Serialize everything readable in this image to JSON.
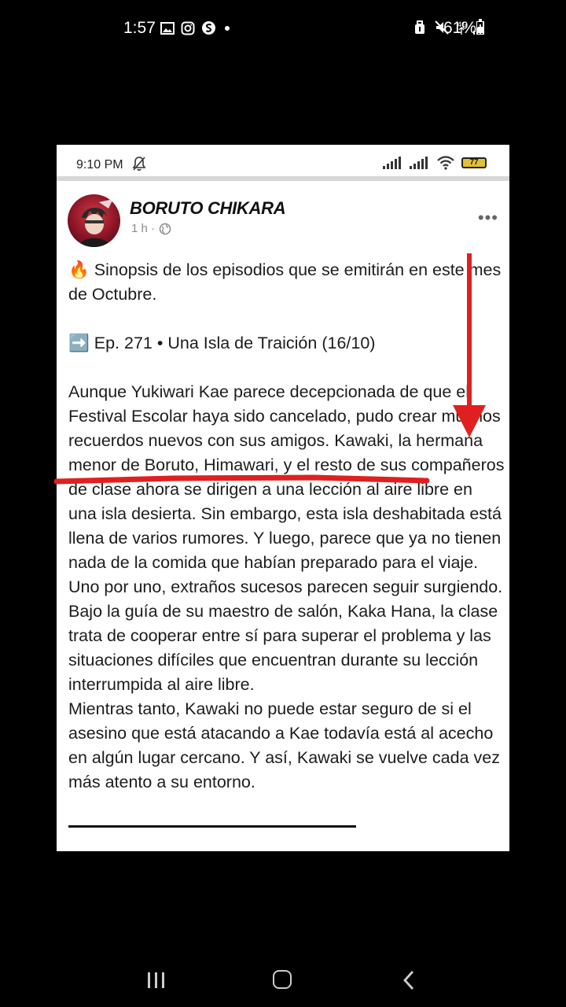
{
  "status_bar": {
    "time": "1:57",
    "battery": "61%",
    "icons_left": [
      "image-icon",
      "instagram-icon",
      "app-icon"
    ],
    "icons_right": [
      "alarm-icon",
      "mute-icon",
      "4g-signal-icon"
    ]
  },
  "screenshot": {
    "status_time": "9:10 PM",
    "battery_level": "77",
    "battery_color": "#e5c030"
  },
  "post": {
    "author": "BORUTO CHIKARA",
    "meta": "1 h ·",
    "intro": "🔥 Sinopsis de los episodios que se emitirán en este mes de Octubre.",
    "episode": "➡️ Ep. 271 • Una Isla de Traición (16/10)",
    "paragraph_1": "Aunque Yukiwari Kae parece decepcionada de que el Festival Escolar haya sido cancelado, pudo crear muchos recuerdos nuevos con sus amigos. Kawaki, la hermana menor de Boruto, Himawari, y el resto de sus compañeros de clase ahora se dirigen a una lección al aire libre en una isla desierta. Sin embargo, esta isla deshabitada está llena de varios rumores. Y luego, parece que ya no tienen nada de la comida que habían preparado para el viaje. Uno por uno, extraños sucesos parecen seguir surgiendo.",
    "paragraph_2": "Bajo la guía de su maestro de salón, Kaka Hana, la clase trata de cooperar entre sí para superar el problema y las situaciones difíciles que encuentran durante su lección interrumpida al aire libre.",
    "paragraph_3": "Mientras tanto, Kawaki no puede estar seguro de si el asesino que está atacando a Kae todavía está al acecho en algún lugar cercano. Y así, Kawaki se vuelve cada vez más atento a su entorno."
  },
  "annotation_color": "#e02020"
}
